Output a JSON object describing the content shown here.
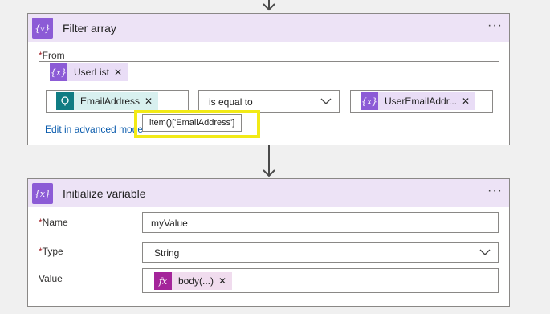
{
  "filter_array": {
    "title": "Filter array",
    "icon": "filter-variable-icon",
    "from_label": "From",
    "from_token": "UserList",
    "left_token": "EmailAddress",
    "operator": "is equal to",
    "right_token": "UserEmailAddr...",
    "advanced_link": "Edit in advanced mode",
    "tooltip": "item()['EmailAddress']"
  },
  "initialize_variable": {
    "title": "Initialize variable",
    "icon": "variable-icon",
    "name_label": "Name",
    "name_value": "myValue",
    "type_label": "Type",
    "type_value": "String",
    "value_label": "Value",
    "value_token": "body(...)"
  },
  "colors": {
    "header_bg": "#ede3f6",
    "variable_purple": "#8c5bd6",
    "dataverse_teal": "#107c83",
    "expression_magenta": "#a4249a",
    "highlight_yellow": "#f2ea16",
    "required_red": "#a4262c",
    "link_blue": "#0b5cad"
  }
}
